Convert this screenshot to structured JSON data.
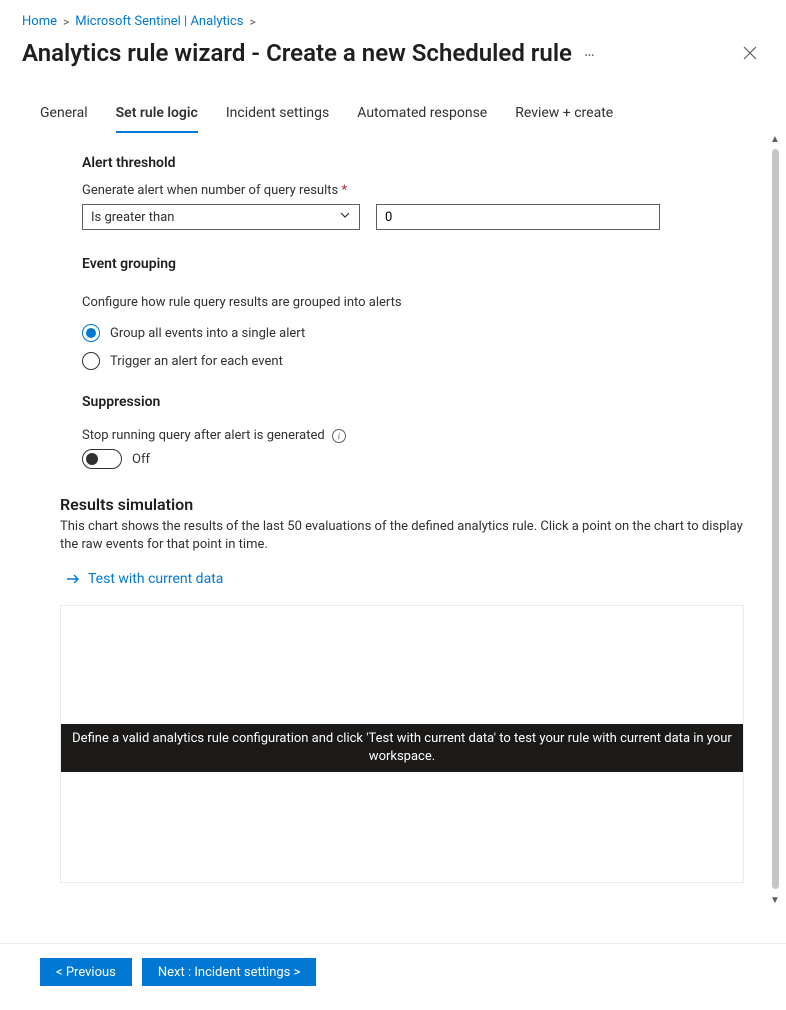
{
  "breadcrumb": {
    "home": "Home",
    "sentinel": "Microsoft Sentinel | Analytics"
  },
  "header": {
    "title": "Analytics rule wizard - Create a new Scheduled rule"
  },
  "tabs": {
    "general": "General",
    "set_rule_logic": "Set rule logic",
    "incident_settings": "Incident settings",
    "automated_response": "Automated response",
    "review_create": "Review + create"
  },
  "alert_threshold": {
    "title": "Alert threshold",
    "label": "Generate alert when number of query results",
    "operator": "Is greater than",
    "value": "0"
  },
  "event_grouping": {
    "title": "Event grouping",
    "desc": "Configure how rule query results are grouped into alerts",
    "option_single": "Group all events into a single alert",
    "option_each": "Trigger an alert for each event",
    "selected": "single"
  },
  "suppression": {
    "title": "Suppression",
    "label": "Stop running query after alert is generated",
    "toggle_state": "Off"
  },
  "results": {
    "title": "Results simulation",
    "desc": "This chart shows the results of the last 50 evaluations of the defined analytics rule. Click a point on the chart to display the raw events for that point in time.",
    "test_link": "Test with current data",
    "overlay": "Define a valid analytics rule configuration and click 'Test with current data' to test your rule with current data in your workspace."
  },
  "footer": {
    "prev": "<  Previous",
    "next": "Next : Incident settings  >"
  }
}
